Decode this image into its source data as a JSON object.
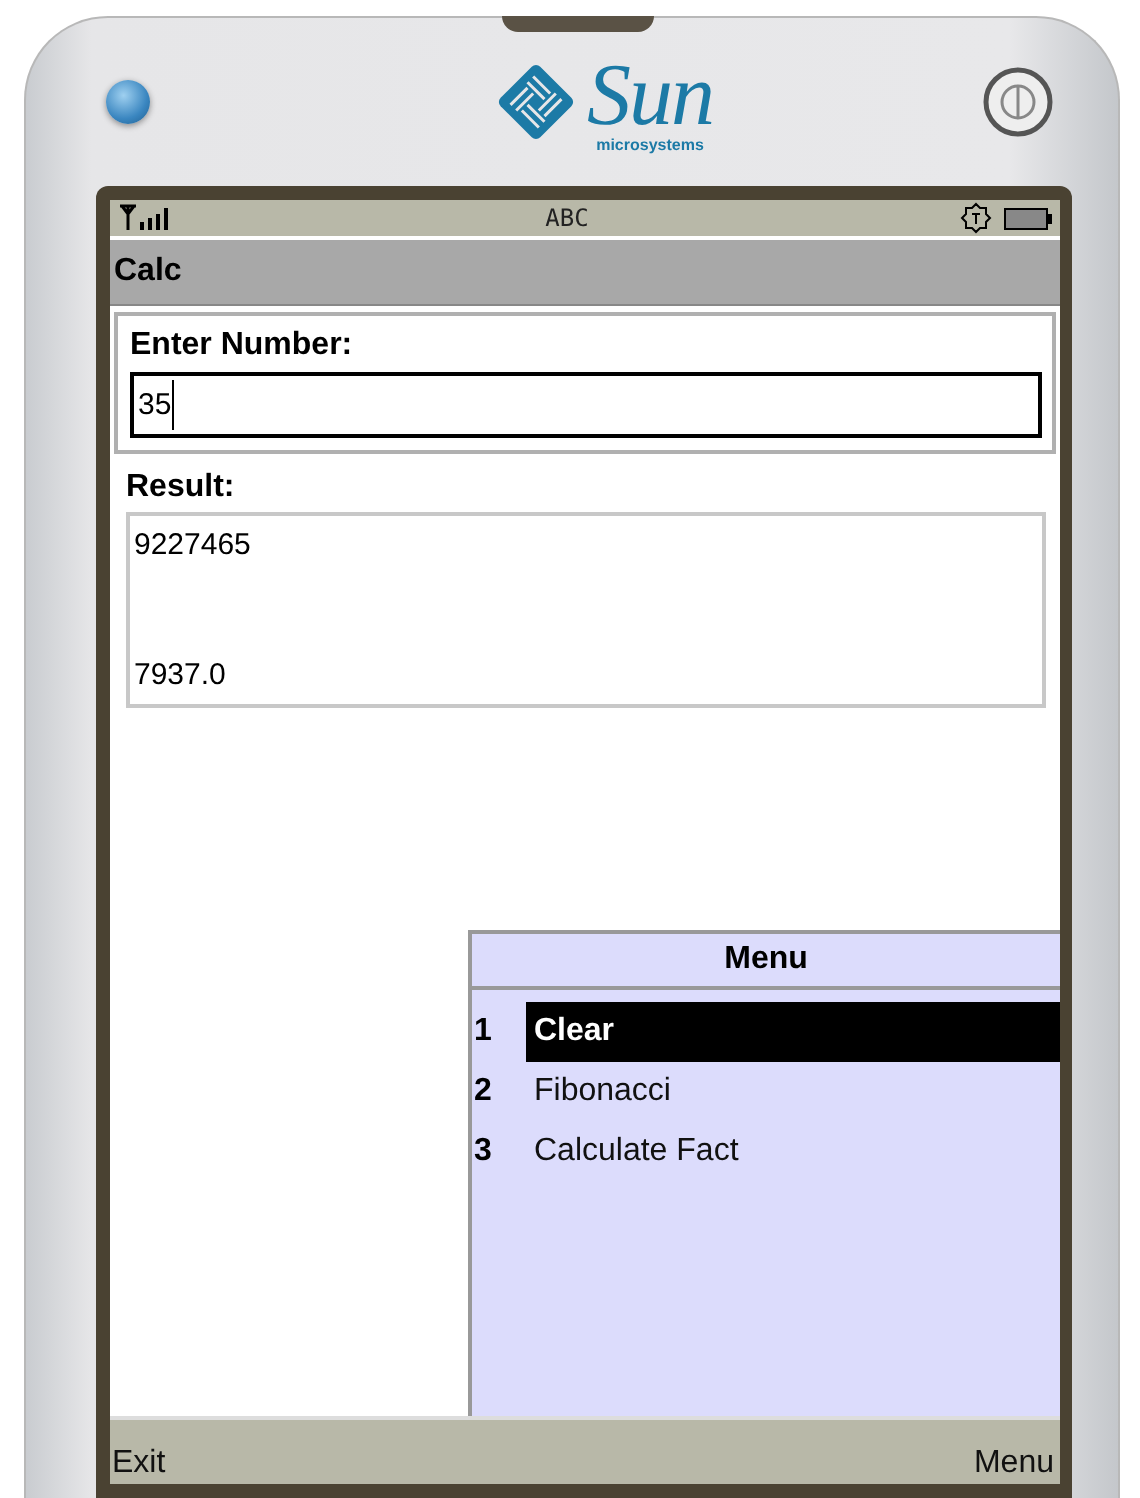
{
  "device": {
    "logo": {
      "wordmark": "Sun",
      "tagline": "microsystems"
    }
  },
  "status_bar": {
    "input_mode": "ABC"
  },
  "title": "Calc",
  "form": {
    "label": "Enter Number:",
    "value": "35"
  },
  "result": {
    "label": "Result:",
    "lines": [
      "9227465",
      "7937.0"
    ]
  },
  "menu": {
    "title": "Menu",
    "items": [
      {
        "number": "1",
        "label": "Clear",
        "selected": true
      },
      {
        "number": "2",
        "label": "Fibonacci",
        "selected": false
      },
      {
        "number": "3",
        "label": "Calculate Fact",
        "selected": false
      }
    ]
  },
  "softkeys": {
    "left": "Exit",
    "right": "Menu"
  }
}
